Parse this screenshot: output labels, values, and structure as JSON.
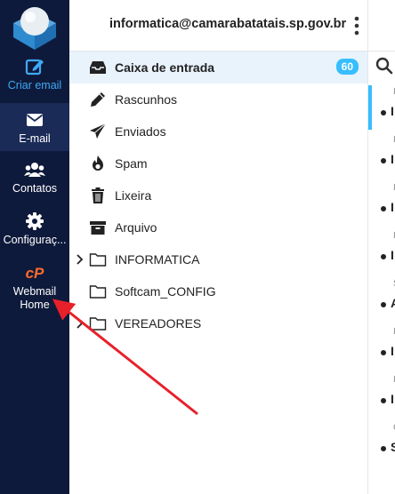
{
  "nav": {
    "compose_label": "Criar email",
    "mail_label": "E-mail",
    "contacts_label": "Contatos",
    "settings_label": "Configuraç...",
    "cpanel_line1": "Webmail",
    "cpanel_line2": "Home"
  },
  "header": {
    "account": "informatica@camarabatatais.sp.gov.br"
  },
  "folders": {
    "inbox": {
      "label": "Caixa de entrada",
      "count": "60"
    },
    "drafts": {
      "label": "Rascunhos"
    },
    "sent": {
      "label": "Enviados"
    },
    "spam": {
      "label": "Spam"
    },
    "trash": {
      "label": "Lixeira"
    },
    "archive": {
      "label": "Arquivo"
    },
    "informatica": {
      "label": "INFORMATICA"
    },
    "softcam": {
      "label": "Softcam_CONFIG"
    },
    "vereadores": {
      "label": "VEREADORES"
    }
  },
  "message_list": {
    "rows": [
      {
        "meta": "I",
        "initial": "I"
      },
      {
        "meta": "I",
        "initial": "I"
      },
      {
        "meta": "I",
        "initial": "I"
      },
      {
        "meta": "I",
        "initial": "I"
      },
      {
        "meta": "S",
        "initial": "A"
      },
      {
        "meta": "I",
        "initial": "I"
      },
      {
        "meta": "I",
        "initial": "I"
      },
      {
        "meta": "C",
        "initial": "S"
      }
    ]
  },
  "colors": {
    "nav_bg": "#0e1a3b",
    "accent": "#37beff",
    "cpanel_orange": "#ff6c2c",
    "annotation": "#e8202a"
  }
}
